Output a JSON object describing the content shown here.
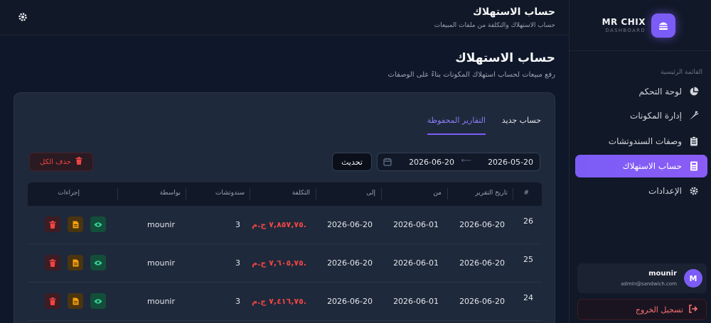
{
  "brand": {
    "name": "MR CHIX",
    "sub": "DASHBOARD"
  },
  "sidebar": {
    "heading": "القائمة الرئيسية",
    "items": [
      {
        "label": "لوحة التحكم",
        "icon": "pie-chart-icon"
      },
      {
        "label": "إدارة المكونات",
        "icon": "carrot-icon"
      },
      {
        "label": "وصفات السندوتشات",
        "icon": "clipboard-icon"
      },
      {
        "label": "حساب الاستهلاك",
        "icon": "calculator-icon",
        "active": true
      },
      {
        "label": "الإعدادات",
        "icon": "gear-icon"
      }
    ],
    "user": {
      "initial": "M",
      "name": "mounir",
      "email": "admin@sandwich.com"
    },
    "logout": "تسجيل الخروج"
  },
  "header": {
    "title": "حساب الاستهلاك",
    "subtitle": "حساب الاستهلاك والتكلفة من ملفات المبيعات"
  },
  "page": {
    "title": "حساب الاستهلاك",
    "subtitle": "رفع مبيعات لحساب استهلاك المكونات بناءً على الوصفات"
  },
  "tabs": {
    "new": "حساب جديد",
    "saved": "التقارير المحفوظة"
  },
  "filters": {
    "from": "2026-05-20",
    "to": "2026-06-20",
    "refresh": "تحديث",
    "delete_all": "حذف الكل"
  },
  "table": {
    "headers": [
      "#",
      "تاريخ التقرير",
      "من",
      "إلى",
      "التكلفة",
      "سندوتشات",
      "بواسطة",
      "إجراءات"
    ],
    "rows": [
      {
        "num": "26",
        "date": "2026-06-20",
        "from": "2026-06-01",
        "to": "2026-06-20",
        "cost": "٧,٨٥٧,٧٥ ج.م.",
        "sandwiches": "3",
        "by": "mounir"
      },
      {
        "num": "25",
        "date": "2026-06-20",
        "from": "2026-06-01",
        "to": "2026-06-20",
        "cost": "٧,٦٠٥,٧٥ ج.م.",
        "sandwiches": "3",
        "by": "mounir"
      },
      {
        "num": "24",
        "date": "2026-06-20",
        "from": "2026-06-01",
        "to": "2026-06-20",
        "cost": "٧,٤١٦,٧٥ ج.م.",
        "sandwiches": "3",
        "by": "mounir"
      }
    ]
  },
  "colors": {
    "accent": "#7c5cf6",
    "danger": "#ef4444",
    "bg": "#0f172a"
  }
}
